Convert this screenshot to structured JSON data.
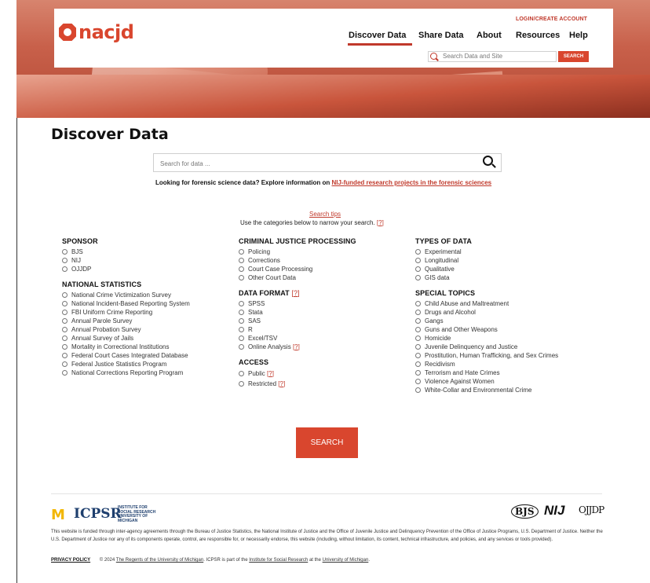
{
  "header": {
    "logo_text": "nacjd",
    "login": "LOGIN/CREATE ACCOUNT",
    "nav": [
      "Discover Data",
      "Share Data",
      "About",
      "Resources",
      "Help"
    ],
    "site_search_placeholder": "Search Data and Site",
    "site_search_button": "SEARCH"
  },
  "page": {
    "title": "Discover Data",
    "search_placeholder": "Search for data ...",
    "forensic_text": "Looking for forensic science data? Explore information on",
    "forensic_link": "NIJ-funded research projects in the forensic sciences",
    "search_tips": "Search tips",
    "categories_hint": "Use the categories below to narrow your search.",
    "help_marker": "?",
    "submit": "SEARCH"
  },
  "filters": {
    "sponsor": {
      "title": "SPONSOR",
      "items": [
        "BJS",
        "NIJ",
        "OJJDP"
      ]
    },
    "national_statistics": {
      "title": "NATIONAL STATISTICS",
      "items": [
        "National Crime Victimization Survey",
        "National Incident-Based Reporting System",
        "FBI Uniform Crime Reporting",
        "Annual Parole Survey",
        "Annual Probation Survey",
        "Annual Survey of Jails",
        "Mortality in Correctional Institutions",
        "Federal Court Cases Integrated Database",
        "Federal Justice Statistics Program",
        "National Corrections Reporting Program"
      ]
    },
    "cjp": {
      "title": "CRIMINAL JUSTICE PROCESSING",
      "items": [
        "Policing",
        "Corrections",
        "Court Case Processing",
        "Other Court Data"
      ]
    },
    "data_format": {
      "title": "DATA FORMAT",
      "items": [
        "SPSS",
        "Stata",
        "SAS",
        "R",
        "Excel/TSV",
        "Online Analysis"
      ]
    },
    "access": {
      "title": "ACCESS",
      "items": [
        "Public",
        "Restricted"
      ]
    },
    "types_of_data": {
      "title": "TYPES OF DATA",
      "items": [
        "Experimental",
        "Longitudinal",
        "Qualitative",
        "GIS data"
      ]
    },
    "special_topics": {
      "title": "SPECIAL TOPICS",
      "items": [
        "Child Abuse and Maltreatment",
        "Drugs and Alcohol",
        "Gangs",
        "Guns and Other Weapons",
        "Homicide",
        "Juvenile Delinquency and Justice",
        "Prostitution, Human Trafficking, and Sex Crimes",
        "Recidivism",
        "Terrorism and Hate Crimes",
        "Violence Against Women",
        "White-Collar and Environmental Crime"
      ]
    }
  },
  "footer": {
    "um_logo": "M",
    "icpsr": "ICPSR",
    "icpsr_sub": "INSTITUTE FOR SOCIAL RESEARCH UNIVERSITY OF MICHIGAN",
    "agencies": [
      "BJS",
      "NIJ",
      "OJJDP"
    ],
    "funding": "This website is funded through inter-agency agreements through the Bureau of Justice Statistics, the National Institute of Justice and the Office of Juvenile Justice and Delinquency Prevention of the Office of Justice Programs, U.S. Department of Justice. Neither the U.S. Department of Justice nor any of its components operate, control, are responsible for, or necessarily endorse, this website (including, without limitation, its content, technical infrastructure, and policies, and any services or tools provided).",
    "privacy": "PRIVACY POLICY",
    "copyright_prefix": "© 2024",
    "regents": "The Regents of the University of Michigan",
    "copyright_mid": ". ICPSR is part of the",
    "isr": "Institute for Social Research",
    "copyright_at": "at the",
    "um": "University of Michigan",
    "copyright_end": "."
  },
  "colors": {
    "accent": "#d9462e",
    "link": "#c0392b"
  }
}
